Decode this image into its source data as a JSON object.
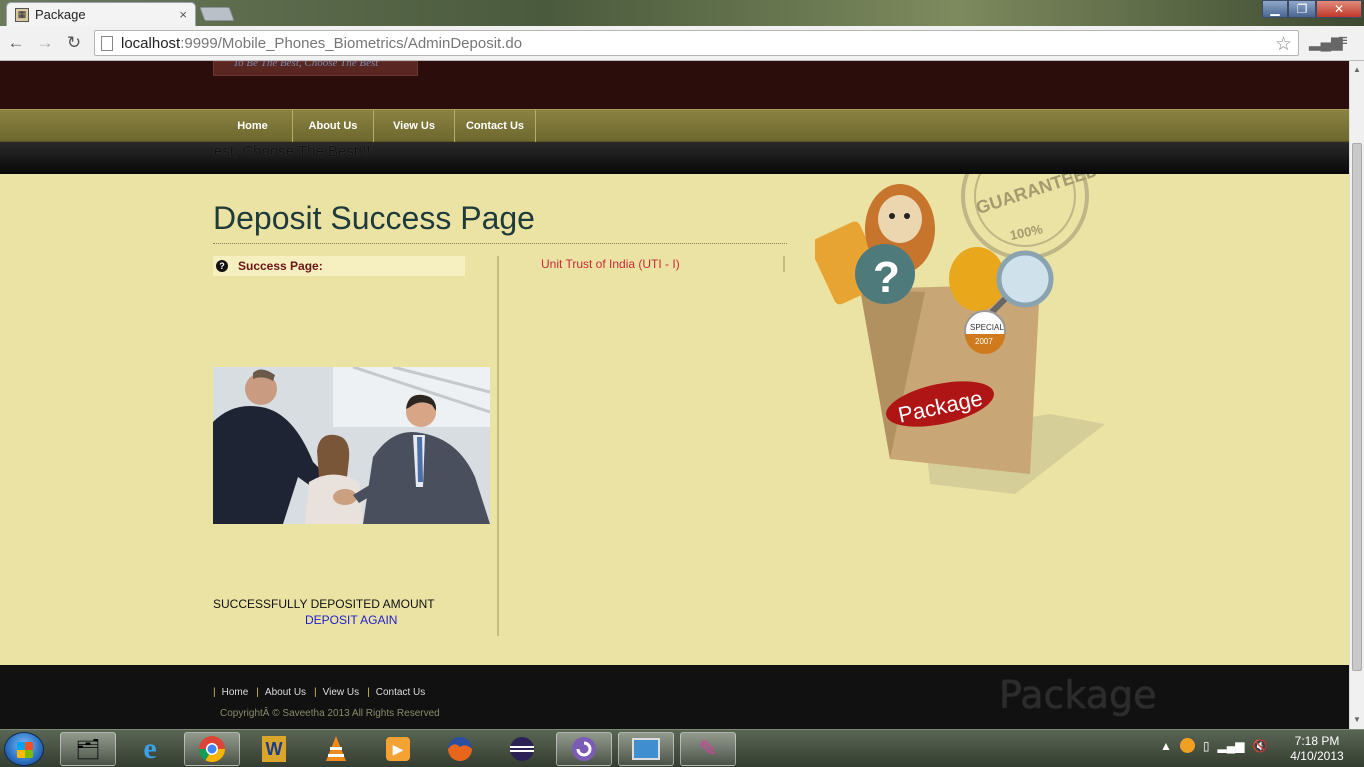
{
  "browser": {
    "tab_title": "Package",
    "tab_close": "×",
    "url_host": "localhost",
    "url_path": ":9999/Mobile_Phones_Biometrics/AdminDeposit.do",
    "window_buttons": [
      "minimize",
      "maximize",
      "close"
    ]
  },
  "site": {
    "tagline": "To Be The Best, Choose The Best",
    "nav": [
      "Home",
      "About Us",
      "View Us",
      "Contact Us"
    ],
    "marquee": "est, Choose The Best!!!"
  },
  "main": {
    "heading": "Deposit Success Page",
    "success_label": "Success Page:",
    "bank_name": "Unit Trust of India (UTI - I)",
    "success_message": "SUCCESSFULLY DEPOSITED AMOUNT",
    "deposit_again": "DEPOSIT AGAIN",
    "hero": {
      "stamp_text": "GUARANTEED",
      "stamp_sub": "100%",
      "badge_line1": "SPECIAL",
      "badge_line2": "2007",
      "bag_label": "Package"
    }
  },
  "footer": {
    "links": [
      "Home",
      "About Us",
      "View Us",
      "Contact Us"
    ],
    "copyright": "CopyrightÂ © Saveetha 2013 All Rights Reserved",
    "logo": "Package"
  },
  "taskbar": {
    "apps": [
      "windows-explorer-icon",
      "internet-explorer-icon",
      "chrome-icon",
      "word-icon",
      "vlc-icon",
      "media-player-icon",
      "firefox-icon",
      "eclipse-icon",
      "bittorrent-icon",
      "remote-desktop-icon",
      "paint-tool-icon"
    ],
    "time": "7:18 PM",
    "date": "4/10/2013"
  }
}
